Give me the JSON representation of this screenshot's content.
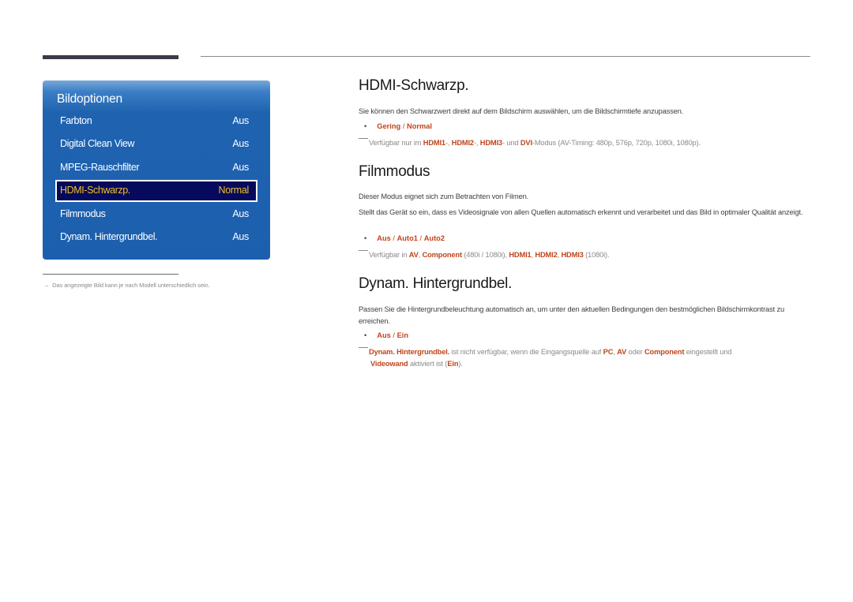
{
  "menu": {
    "title": "Bildoptionen",
    "items": [
      {
        "label": "Farbton",
        "value": "Aus"
      },
      {
        "label": "Digital Clean View",
        "value": "Aus"
      },
      {
        "label": "MPEG-Rauschfilter",
        "value": "Aus"
      },
      {
        "label": "HDMI-Schwarzp.",
        "value": "Normal",
        "selected": true
      },
      {
        "label": "Filmmodus",
        "value": "Aus"
      },
      {
        "label": "Dynam. Hintergrundbel.",
        "value": "Aus"
      }
    ]
  },
  "footnote": {
    "dash": "–",
    "text": "Das angezeigte Bild kann je nach Modell unterschiedlich sein."
  },
  "sections": {
    "hdmi": {
      "title": "HDMI-Schwarzp.",
      "para": "Sie können den Schwarzwert direkt auf dem Bildschirm auswählen, um die Bildschirmtiefe anzupassen.",
      "bullet_dot": "•",
      "options": [
        "Gering",
        "Normal"
      ],
      "separator": " / ",
      "note": {
        "t1": "Verfügbar nur im ",
        "h1": "HDMI1",
        "t2": "-, ",
        "h2": "HDMI2",
        "t3": "-, ",
        "h3": "HDMI3",
        "t4": "- und ",
        "h4": "DVI",
        "t5": "-Modus (AV-Timing: 480p, 576p, 720p, 1080i, 1080p)."
      }
    },
    "film": {
      "title": "Filmmodus",
      "para1": "Dieser Modus eignet sich zum Betrachten von Filmen.",
      "para2": "Stellt das Gerät so ein, dass es Videosignale von allen Quellen automatisch erkennt und verarbeitet und das Bild in optimaler Qualität anzeigt.",
      "bullet_dot": "•",
      "options": [
        "Aus",
        "Auto1",
        "Auto2"
      ],
      "separator": " / ",
      "note": {
        "t1": "Verfügbar in ",
        "h1": "AV",
        "t2": ", ",
        "h2": "Component",
        "t3": " (480i / 1080i), ",
        "h3": "HDMI1",
        "t4": ", ",
        "h4": "HDMI2",
        "t5": ", ",
        "h5": "HDMI3",
        "t6": " (1080i)."
      }
    },
    "dynam": {
      "title": "Dynam. Hintergrundbel.",
      "para": "Passen Sie die Hintergrundbeleuchtung automatisch an, um unter den aktuellen Bedingungen den bestmöglichen Bildschirmkontrast zu erreichen.",
      "bullet_dot": "•",
      "options": [
        "Aus",
        "Ein"
      ],
      "separator": " / ",
      "note": {
        "h1": "Dynam. Hintergrundbel.",
        "t1": " ist nicht verfügbar, wenn die Eingangsquelle auf ",
        "h2": "PC",
        "t2": ", ",
        "h3": "AV",
        "t3": " oder ",
        "h4": "Component",
        "t4": " eingestellt und",
        "h5": "Videowand",
        "t5": " aktiviert ist (",
        "h6": "Ein",
        "t6": ")."
      }
    }
  },
  "colors": {
    "accent": "#c0441b",
    "panel_blue": "#1f63b0",
    "selected_bg": "#050a5c",
    "selected_text": "#f0c020"
  }
}
